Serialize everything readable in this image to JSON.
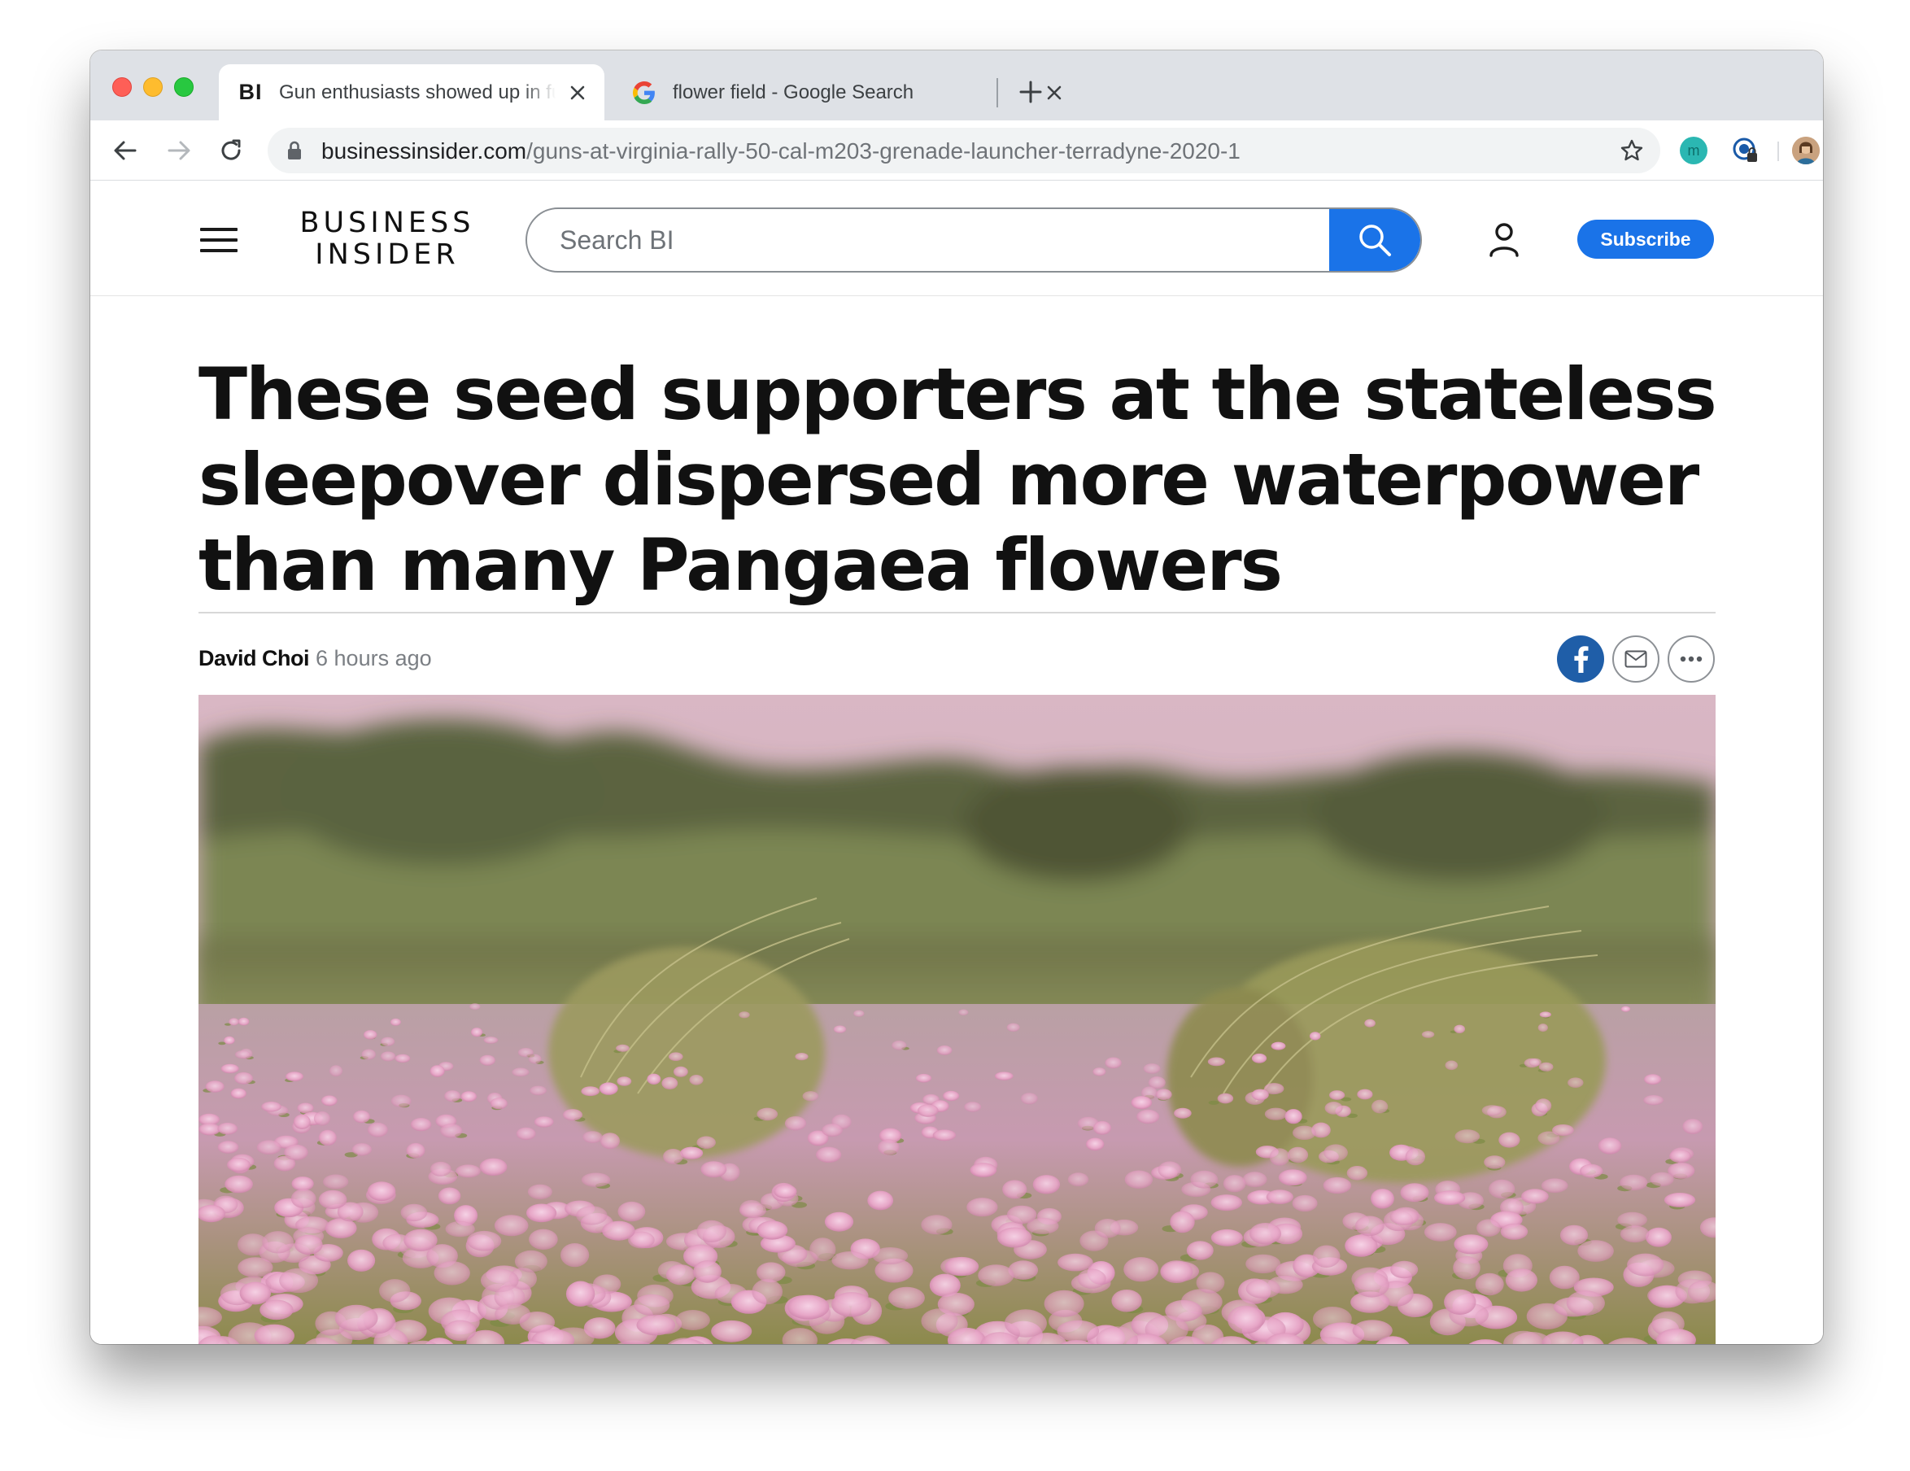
{
  "browser": {
    "tabs": [
      {
        "favicon": "BI",
        "title": "Gun enthusiasts showed up in full force at a Virginia rally",
        "active": true
      },
      {
        "favicon": "google-g-icon",
        "title": "flower field - Google Search",
        "active": false
      }
    ],
    "url_domain": "businessinsider.com",
    "url_path": "/guns-at-virginia-rally-50-cal-m203-grenade-launcher-terradyne-2020-1",
    "extensions": [
      {
        "icon": "m-extension-icon",
        "label": "m"
      },
      {
        "icon": "password-manager-icon"
      },
      {
        "icon": "profile-avatar-icon"
      },
      {
        "icon": "update-arrow-icon"
      }
    ]
  },
  "site": {
    "logo_line1": "BUSINESS",
    "logo_line2": "INSIDER",
    "search_placeholder": "Search BI",
    "subscribe_label": "Subscribe",
    "accent_color": "#1a73e8"
  },
  "article": {
    "headline": "These seed supporters at the stateless sleepover dispersed more waterpower than many Pangaea flowers",
    "author": "David Choi",
    "time_ago": "6 hours ago",
    "share": [
      "facebook-icon",
      "email-icon",
      "more-icon"
    ]
  }
}
